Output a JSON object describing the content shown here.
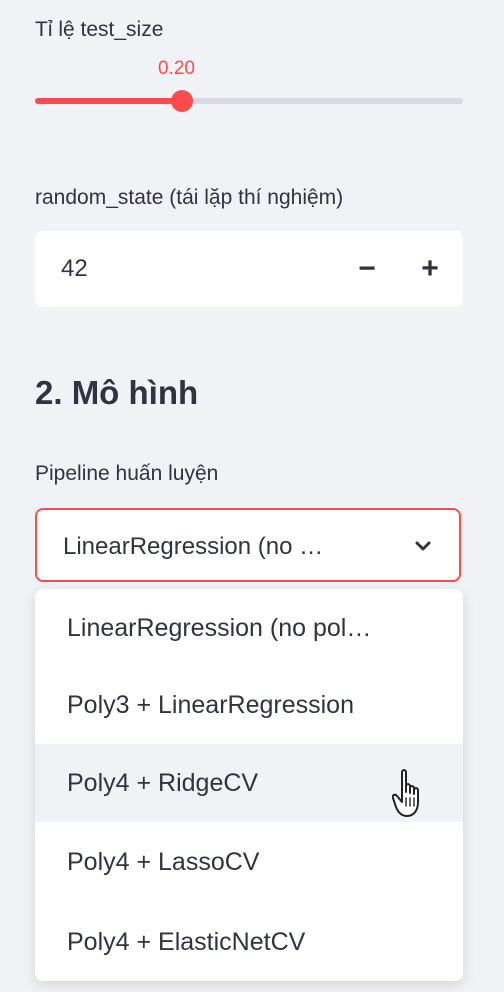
{
  "slider": {
    "label": "Tỉ lệ test_size",
    "value_text": "0.20",
    "fraction": 0.343
  },
  "random_state": {
    "label": "random_state (tái lặp thí nghiệm)",
    "value": "42",
    "minus": "−",
    "plus": "+"
  },
  "section": {
    "title": "2. Mô hình"
  },
  "pipeline": {
    "label": "Pipeline huấn luyện",
    "selected": "LinearRegression (no …",
    "options": [
      "LinearRegression (no pol…",
      "Poly3 + LinearRegression",
      "Poly4 + RidgeCV",
      "Poly4 + LassoCV",
      "Poly4 + ElasticNetCV"
    ],
    "hovered_index": 2
  },
  "colors": {
    "accent": "#ff4b4b",
    "background": "#f0f2f6",
    "text": "#31333f"
  },
  "icons": {
    "dropdown": "chevron-down-icon",
    "cursor": "hand-pointer-icon"
  }
}
